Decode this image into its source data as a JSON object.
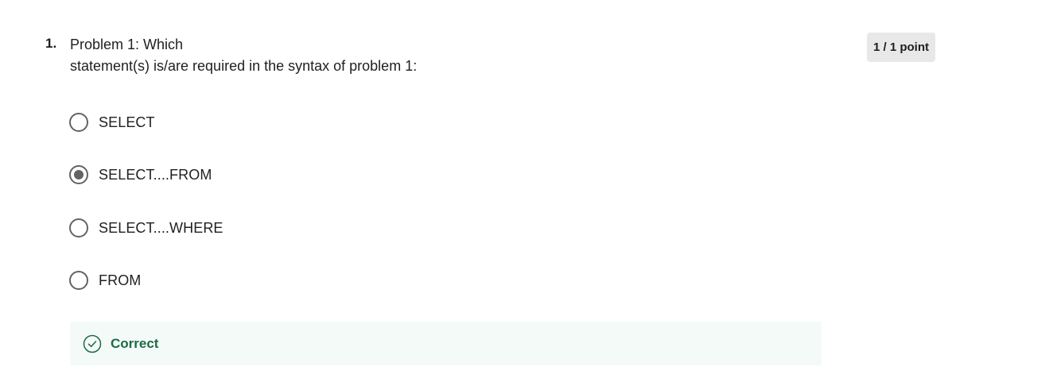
{
  "question": {
    "number": "1.",
    "text_line1": "Problem 1: Which",
    "text_line2": "statement(s) is/are required in the syntax of problem 1:",
    "points": "1 / 1 point"
  },
  "options": [
    {
      "label": "SELECT",
      "selected": false
    },
    {
      "label": "SELECT....FROM",
      "selected": true
    },
    {
      "label": "SELECT....WHERE",
      "selected": false
    },
    {
      "label": "FROM",
      "selected": false
    }
  ],
  "feedback": {
    "label": "Correct",
    "icon": "check-circle-icon",
    "color": "#1b6b48",
    "background": "#f4faf7"
  }
}
